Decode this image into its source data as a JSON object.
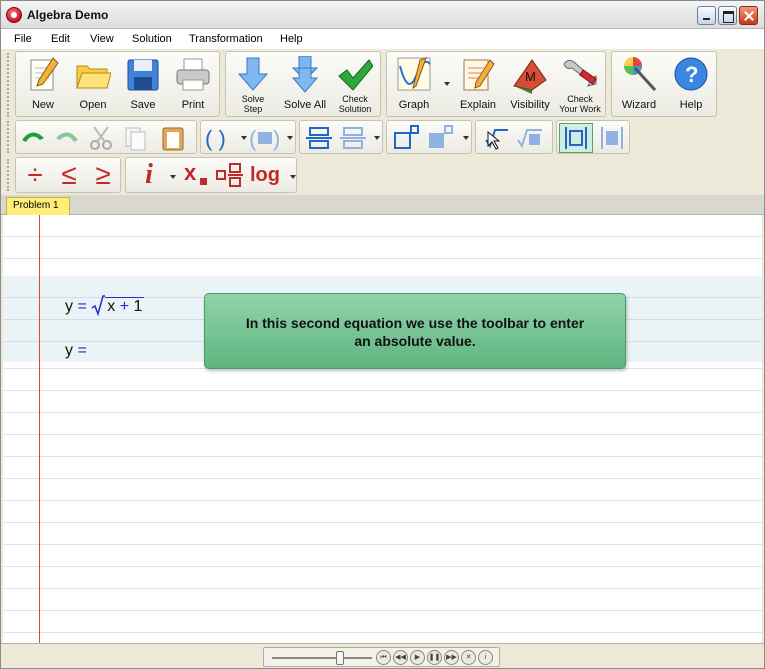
{
  "window": {
    "title": "Algebra Demo"
  },
  "menu": [
    "File",
    "Edit",
    "View",
    "Solution",
    "Transformation",
    "Help"
  ],
  "toolbar_main": {
    "new": "New",
    "open": "Open",
    "save": "Save",
    "print": "Print",
    "solve_step_1": "Solve",
    "solve_step_2": "Step",
    "solve_all": "Solve All",
    "check_solution_1": "Check",
    "check_solution_2": "Solution",
    "graph": "Graph",
    "explain": "Explain",
    "visibility": "Visibility",
    "visibility_glyph": "M",
    "check_work_1": "Check",
    "check_work_2": "Your Work",
    "wizard": "Wizard",
    "help": "Help",
    "help_glyph": "?"
  },
  "toolbar_math": {
    "divide": "÷",
    "less_equal": "≤",
    "greater_equal": "≥",
    "italic_i": "i",
    "subscript_x": "x",
    "log": "log"
  },
  "tabs": [
    "Problem 1"
  ],
  "equations": [
    {
      "lhs": "y",
      "eq": "=",
      "rhs_parts": [
        "x",
        "+",
        "1"
      ]
    },
    {
      "lhs": "y",
      "eq": "="
    }
  ],
  "callout": {
    "line1": "In this second equation we use the toolbar to enter",
    "line2": "an absolute value."
  },
  "colors": {
    "accent_blue": "#1d2fd1",
    "margin_red": "#d64a3a",
    "tab_yellow": "#ffef7a",
    "callout_green": "#7cc695"
  }
}
